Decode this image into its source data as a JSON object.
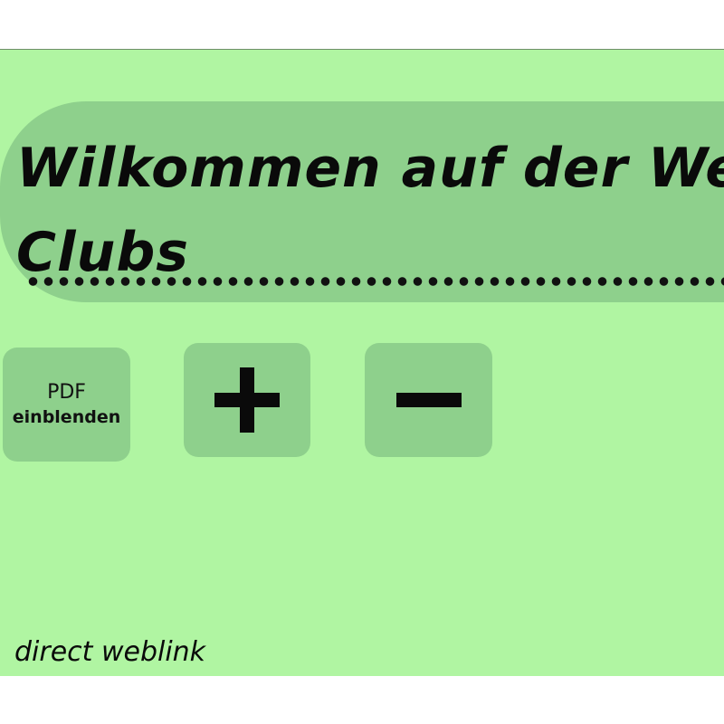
{
  "header": {
    "title_line1": "Wilkommen auf der Websit",
    "title_line2": "Clubs"
  },
  "controls": {
    "pdf_label_line1": "PDF",
    "pdf_label_line2": "einblenden",
    "zoom_in_icon": "plus-icon",
    "zoom_out_icon": "minus-icon"
  },
  "footer": {
    "link_text": "direct weblink"
  },
  "colors": {
    "page_background": "#b0f5a2",
    "banner_and_buttons": "#8ed08c",
    "text": "#0a0a0a"
  }
}
